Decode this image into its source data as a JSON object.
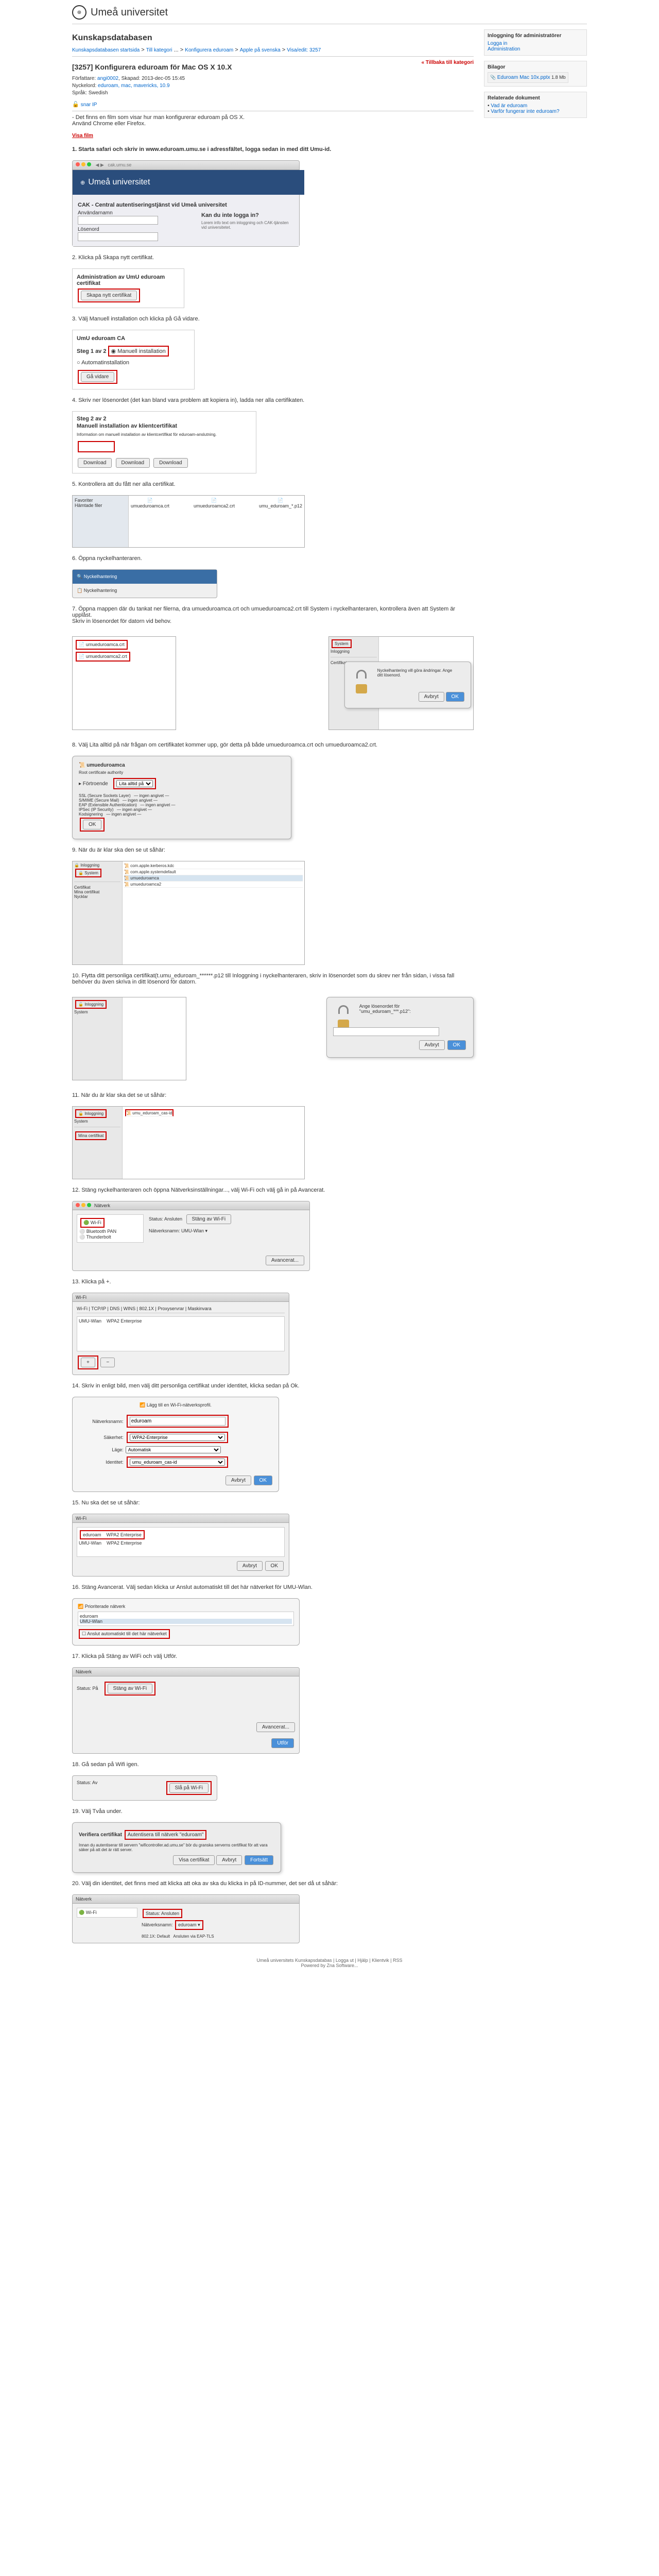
{
  "brand": "Umeå universitet",
  "pageTitle": "Kunskapsdatabasen",
  "breadcrumb": {
    "l1": "Kunskapsdatabasen startsida",
    "l2": "Till kategori",
    "l3": "Konfigurera eduroam",
    "l4": "Apple på svenska",
    "l5": "Visa/edit: 3257"
  },
  "article": {
    "id": "[3257]",
    "title": "Konfigurera eduroam för Mac OS X 10.X",
    "back": "« Tillbaka till kategori",
    "authorLbl": "Författare:",
    "author": "angi0002",
    "datedLbl": "Skapad:",
    "dated": "2013-dec-05 15:45",
    "tagsLbl": "Nyckelord:",
    "tags": "eduroam, mac, mavericks, 10.9",
    "langLbl": "Språk:",
    "lang": "Swedish",
    "intro": "- Det finns en film som visar hur man konfigurerar eduroam på OS X.",
    "intro2": "Använd Chrome eller Firefox.",
    "filmLink": "Visa film"
  },
  "sidebar": {
    "loginTitle": "Inloggning för administratörer",
    "loginBtn": "Logga in",
    "adminLink": "Administration",
    "attachTitle": "Bilagor",
    "attachFile": "Eduroam Mac 10x.pptx",
    "attachSize": "1.8 Mb",
    "relatedTitle": "Relaterade dokument",
    "rel1": "Vad är eduroam",
    "rel2": "Varför fungerar inte eduroam?"
  },
  "cak": {
    "title": "CAK - Central autentiseringstjänst vid Umeå universitet",
    "helpTitle": "Kan du inte logga in?",
    "labelUser": "Användarnamn",
    "labelPass": "Lösenord"
  },
  "steps": {
    "s1": "1. Starta safari och skriv in www.eduroam.umu.se i adressfältet, logga sedan in med ditt Umu-id.",
    "s2": "2. Klicka på Skapa nytt certifikat.",
    "s2box": "Administration av UmU eduroam certifikat",
    "s2btn": "Skapa nytt certifikat",
    "s3": "3. Välj Manuell installation och klicka på Gå vidare.",
    "s3title": "UmU eduroam CA",
    "s3sub": "Steg 1 av 2",
    "s3opt": "Manuell installation",
    "s3btn": "Gå vidare",
    "s4": "4. Skriv ner lösenordet (det kan bland vara problem att kopiera in), ladda ner alla certifikaten.",
    "s4sub": "Steg 2 av 2",
    "s4title": "Manuell installation av klientcertifikat",
    "s5": "5. Kontrollera att du fått ner alla certifikat.",
    "s6": "6. Öppna nyckelhanteraren.",
    "s7": "7. Öppna mappen där du tankat ner filerna, dra umueduroamca.crt och umueduroamca2.crt till System i nyckelhanteraren, kontrollera även att System är upplåst.",
    "s7b": "Skriv in lösenordet för datorn vid behov.",
    "s8": "8. Välj Lita alltid på när frågan om certifikatet kommer upp, gör detta på både umueduroamca.crt och umueduroamca2.crt.",
    "s9": "9. När du är klar ska den se ut såhär:",
    "s10": "10. Flytta ditt personliga certifikat(t.umu_eduroam_******.p12 till Inloggning i nyckelhanteraren, skriv in lösenordet som du skrev ner från sidan, i vissa fall behöver du även skriva in ditt lösenord för datorn.",
    "s11": "11. När du är klar ska det se ut såhär:",
    "s12": "12. Stäng nyckelhanteraren och öppna Nätverksinställningar..., välj Wi-Fi och välj gå in på Avancerat.",
    "s13": "13. Klicka på +.",
    "s14": "14. Skriv in enligt bild, men välj ditt personliga certifikat under identitet, klicka sedan på Ok.",
    "s15": "15. Nu ska det se ut såhär:",
    "s16": "16. Stäng Avancerat. Välj sedan klicka ur Anslut automatiskt till det här nätverket för UMU-Wlan.",
    "s17": "17. Klicka på Stäng av WiFi och välj Utför.",
    "s18": "18. Gå sedan på Wifi igen.",
    "s19": "19. Välj Tvåa under.",
    "s20": "20. Välj din identitet, det finns med att klicka att oka av ska du klicka in på ID-nummer, det ser då ut såhär:",
    "snarIP": "snar IP"
  },
  "mac": {
    "downloads": "Hämtade filer",
    "keychain": "Nyckelhantering",
    "system": "System",
    "login": "Inloggning",
    "certs": "Certifikat",
    "mycerts": "Mina certifikat",
    "keys": "Nycklar",
    "trustAlways": "Lita alltid på",
    "network": "Nätverk",
    "wifi": "Wi-Fi",
    "advanced": "Avancerat...",
    "turnOff": "Stäng av Wi-Fi",
    "apply": "Utför",
    "ok": "OK",
    "cancel": "Avbryt",
    "autoconnect": "Anslut automatiskt till det här nätverket",
    "netname": "Nätverksnamn:",
    "security": "Säkerhet:",
    "mode": "Läge:",
    "identity": "Identitet:",
    "eduroam": "eduroam",
    "wpa2e": "WPA2-Enterprise",
    "auto": "Automatisk",
    "fortsatt": "Fortsätt",
    "verify": "Verifiera certifikat",
    "autentisera": "Autentisera till nätverk \"eduroam\""
  },
  "footer": {
    "text": "Umeå universitets Kunskapsdatabas | Logga ut | Hjälp | Klientvik | RSS",
    "powered": "Powered by Zna Software..."
  }
}
